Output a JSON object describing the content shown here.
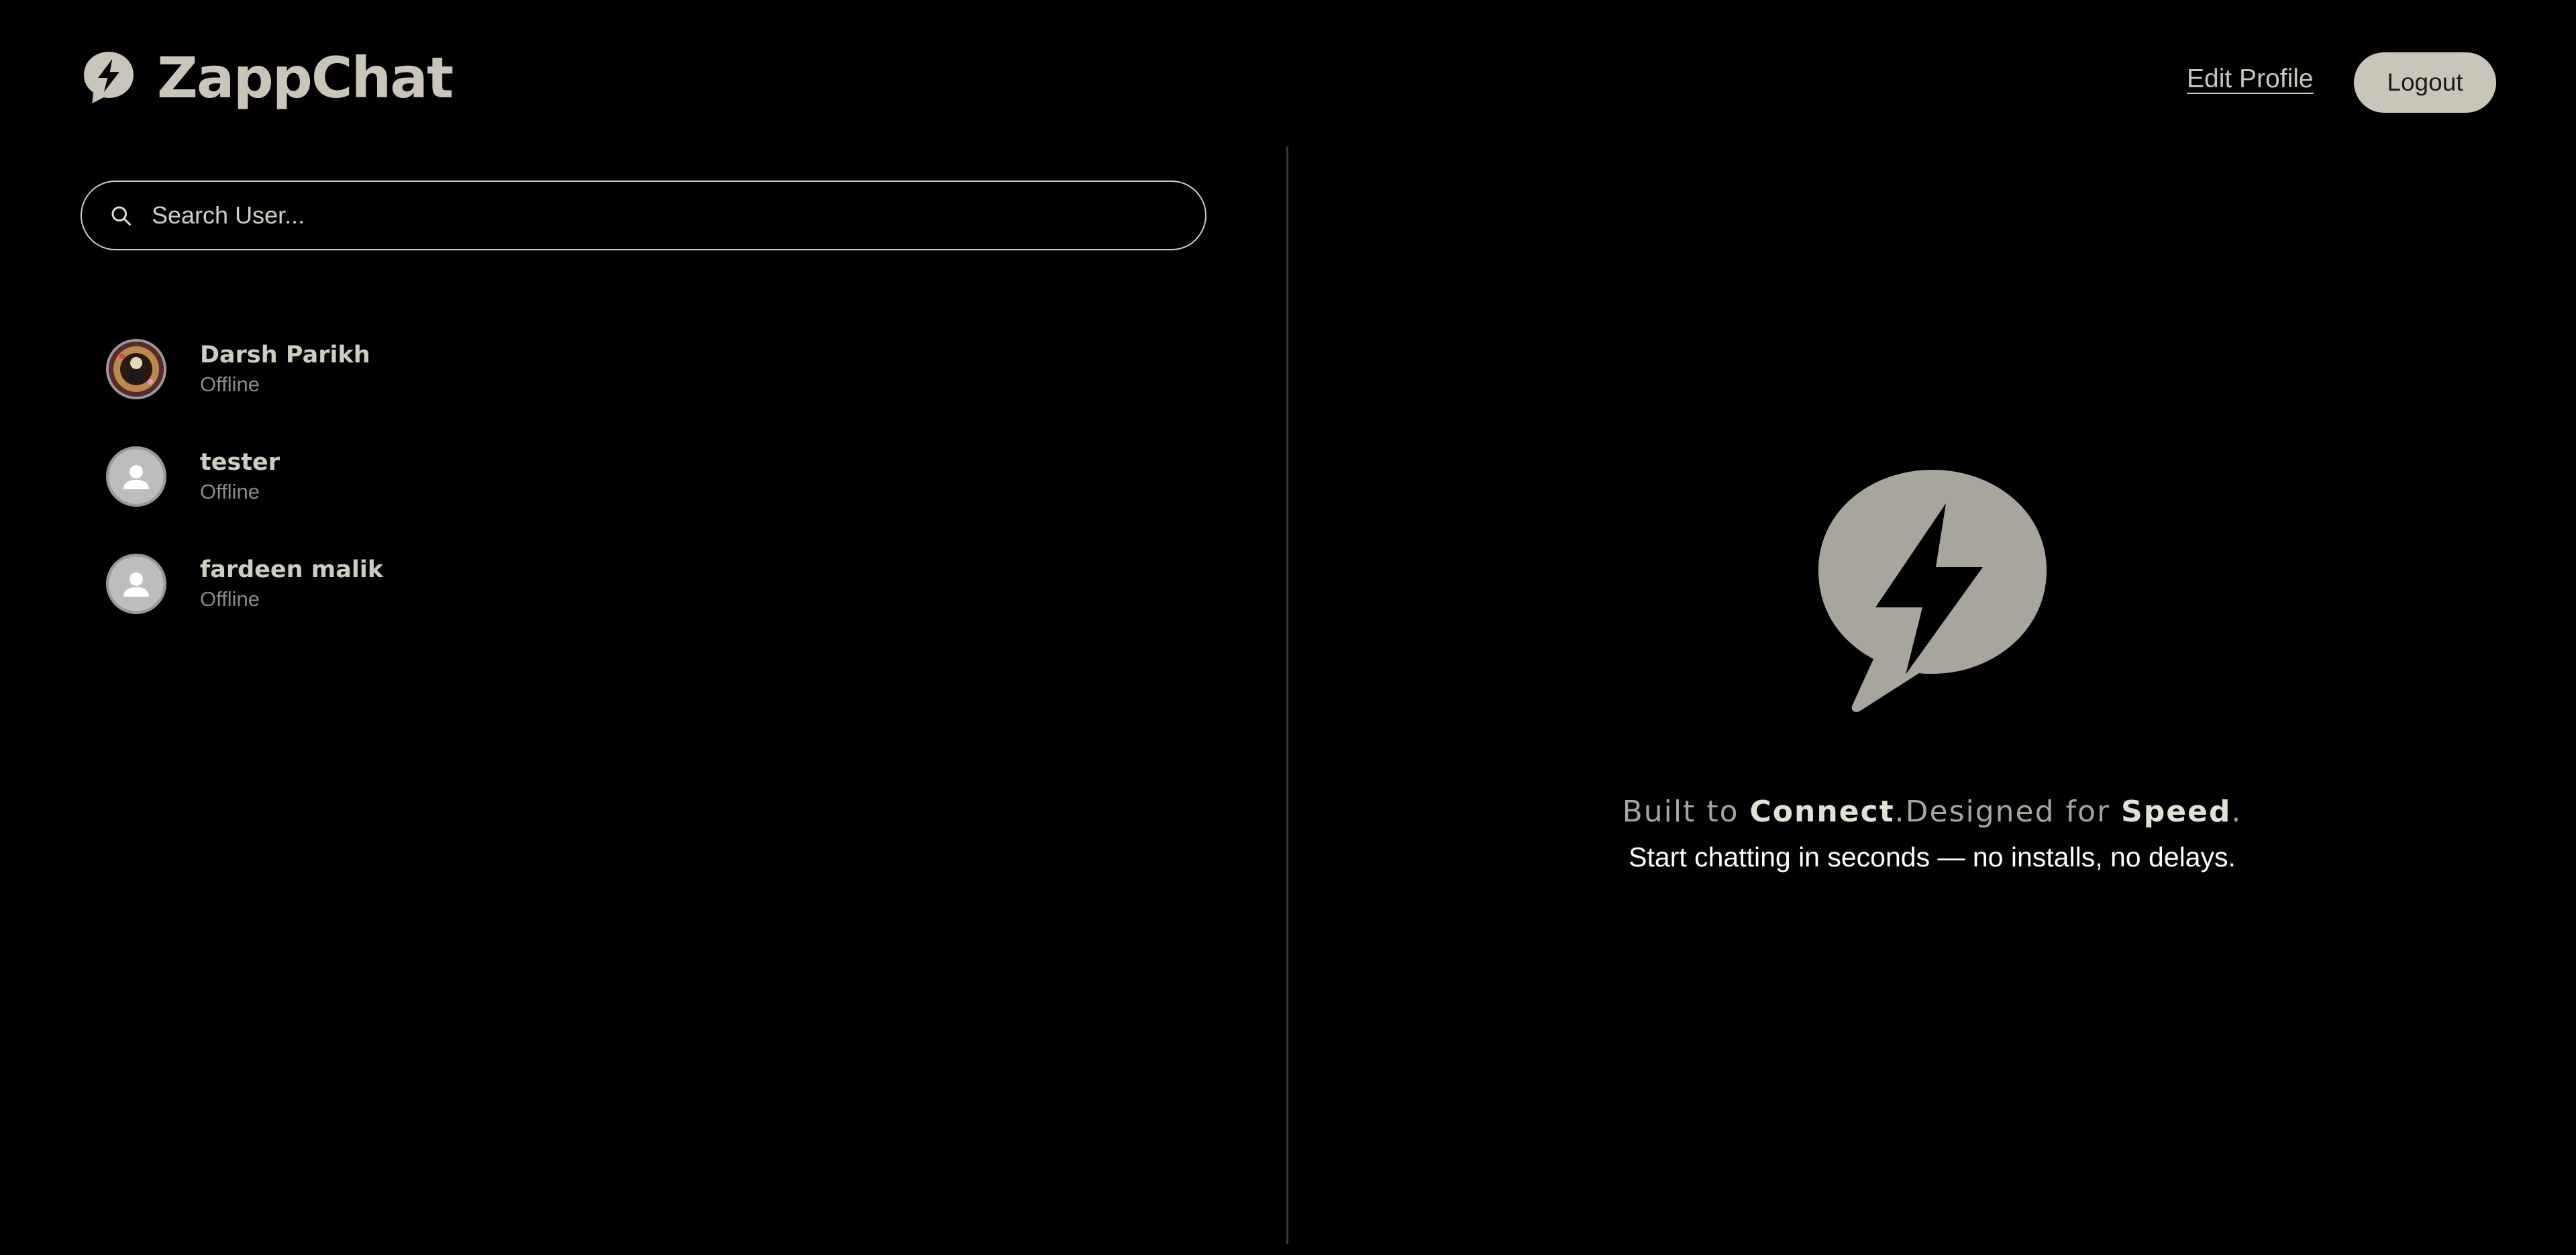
{
  "header": {
    "brand": "ZappChat",
    "edit_profile_label": "Edit Profile",
    "logout_label": "Logout"
  },
  "search": {
    "placeholder": "Search User...",
    "value": ""
  },
  "users": [
    {
      "name": "Darsh Parikh",
      "status": "Offline",
      "avatar": "photo-avatar"
    },
    {
      "name": "tester",
      "status": "Offline",
      "avatar": "default-user-icon"
    },
    {
      "name": "fardeen malik",
      "status": "Offline",
      "avatar": "default-user-icon"
    }
  ],
  "welcome": {
    "tagline_part1": "Built to ",
    "tagline_bold1": "Connect",
    "tagline_part2": ".Designed for ",
    "tagline_bold2": "Speed",
    "tagline_part3": ".",
    "subline": "Start chatting in seconds — no installs, no delays."
  },
  "colors": {
    "background": "#000000",
    "accent": "#c9c6b9",
    "muted": "#8a8a85",
    "icon_fill": "#a8a69c"
  }
}
